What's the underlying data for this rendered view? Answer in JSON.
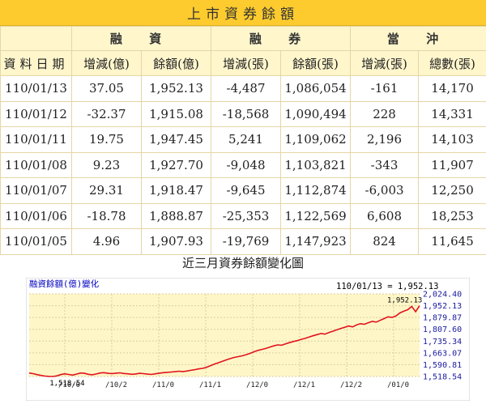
{
  "title": "上市資券餘額",
  "table": {
    "group_headers": [
      "融 資",
      "融 券",
      "當 沖"
    ],
    "date_header": "資料日期",
    "column_headers": [
      "增減(億)",
      "餘額(億)",
      "增減(張)",
      "餘額(張)",
      "增減(張)",
      "總數(張)"
    ],
    "rows": [
      [
        "110/01/13",
        "37.05",
        "1,952.13",
        "-4,487",
        "1,086,054",
        "-161",
        "14,170"
      ],
      [
        "110/01/12",
        "-32.37",
        "1,915.08",
        "-18,568",
        "1,090,494",
        "228",
        "14,331"
      ],
      [
        "110/01/11",
        "19.75",
        "1,947.45",
        "5,241",
        "1,109,062",
        "2,196",
        "14,103"
      ],
      [
        "110/01/08",
        "9.23",
        "1,927.70",
        "-9,048",
        "1,103,821",
        "-343",
        "11,907"
      ],
      [
        "110/01/07",
        "29.31",
        "1,918.47",
        "-9,645",
        "1,112,874",
        "-6,003",
        "12,250"
      ],
      [
        "110/01/06",
        "-18.78",
        "1,888.87",
        "-25,353",
        "1,122,569",
        "6,608",
        "18,253"
      ],
      [
        "110/01/05",
        "4.96",
        "1,907.93",
        "-19,769",
        "1,147,923",
        "824",
        "11,645"
      ]
    ]
  },
  "chart_title": "近三月資券餘額變化圖",
  "chart_data": {
    "type": "line",
    "title": "融資餘額(億)變化",
    "latest_label": "110/01/13 = 1,952.13",
    "min_label": "1,518.54",
    "max_label": "1,952.13",
    "yticks": [
      "2,024.40",
      "1,952.13",
      "1,879.87",
      "1,807.60",
      "1,735.34",
      "1,663.07",
      "1,590.81",
      "1,518.54"
    ],
    "ylim": [
      1518.54,
      2024.4
    ],
    "xticks": [
      "/10/0",
      "/10/2",
      "/11/0",
      "/11/1",
      "/12/0",
      "/12/1",
      "/12/2",
      "/01/0"
    ],
    "colors": {
      "line": "#e0141e",
      "axis_text": "#1a1aa0",
      "title_text": "#0000c0",
      "plot_bg": "#fff6c8"
    },
    "values": [
      1540,
      1536,
      1530,
      1525,
      1521,
      1519,
      1518.54,
      1522,
      1530,
      1535,
      1531,
      1527,
      1533,
      1540,
      1538,
      1532,
      1529,
      1534,
      1540,
      1542,
      1538,
      1536,
      1539,
      1541,
      1537,
      1535,
      1532,
      1534,
      1538,
      1536,
      1533,
      1531,
      1535,
      1539,
      1542,
      1544,
      1546,
      1548,
      1551,
      1549,
      1552,
      1556,
      1560,
      1565,
      1568,
      1575,
      1585,
      1595,
      1603,
      1612,
      1620,
      1628,
      1635,
      1640,
      1645,
      1652,
      1660,
      1670,
      1678,
      1684,
      1690,
      1698,
      1706,
      1712,
      1710,
      1718,
      1726,
      1733,
      1738,
      1746,
      1752,
      1760,
      1768,
      1775,
      1782,
      1778,
      1788,
      1796,
      1804,
      1812,
      1820,
      1828,
      1822,
      1834,
      1842,
      1838,
      1848,
      1856,
      1852,
      1862,
      1873,
      1884,
      1880,
      1888.87,
      1907.93,
      1918.47,
      1927.7,
      1947.45,
      1915.08,
      1952.13
    ]
  }
}
